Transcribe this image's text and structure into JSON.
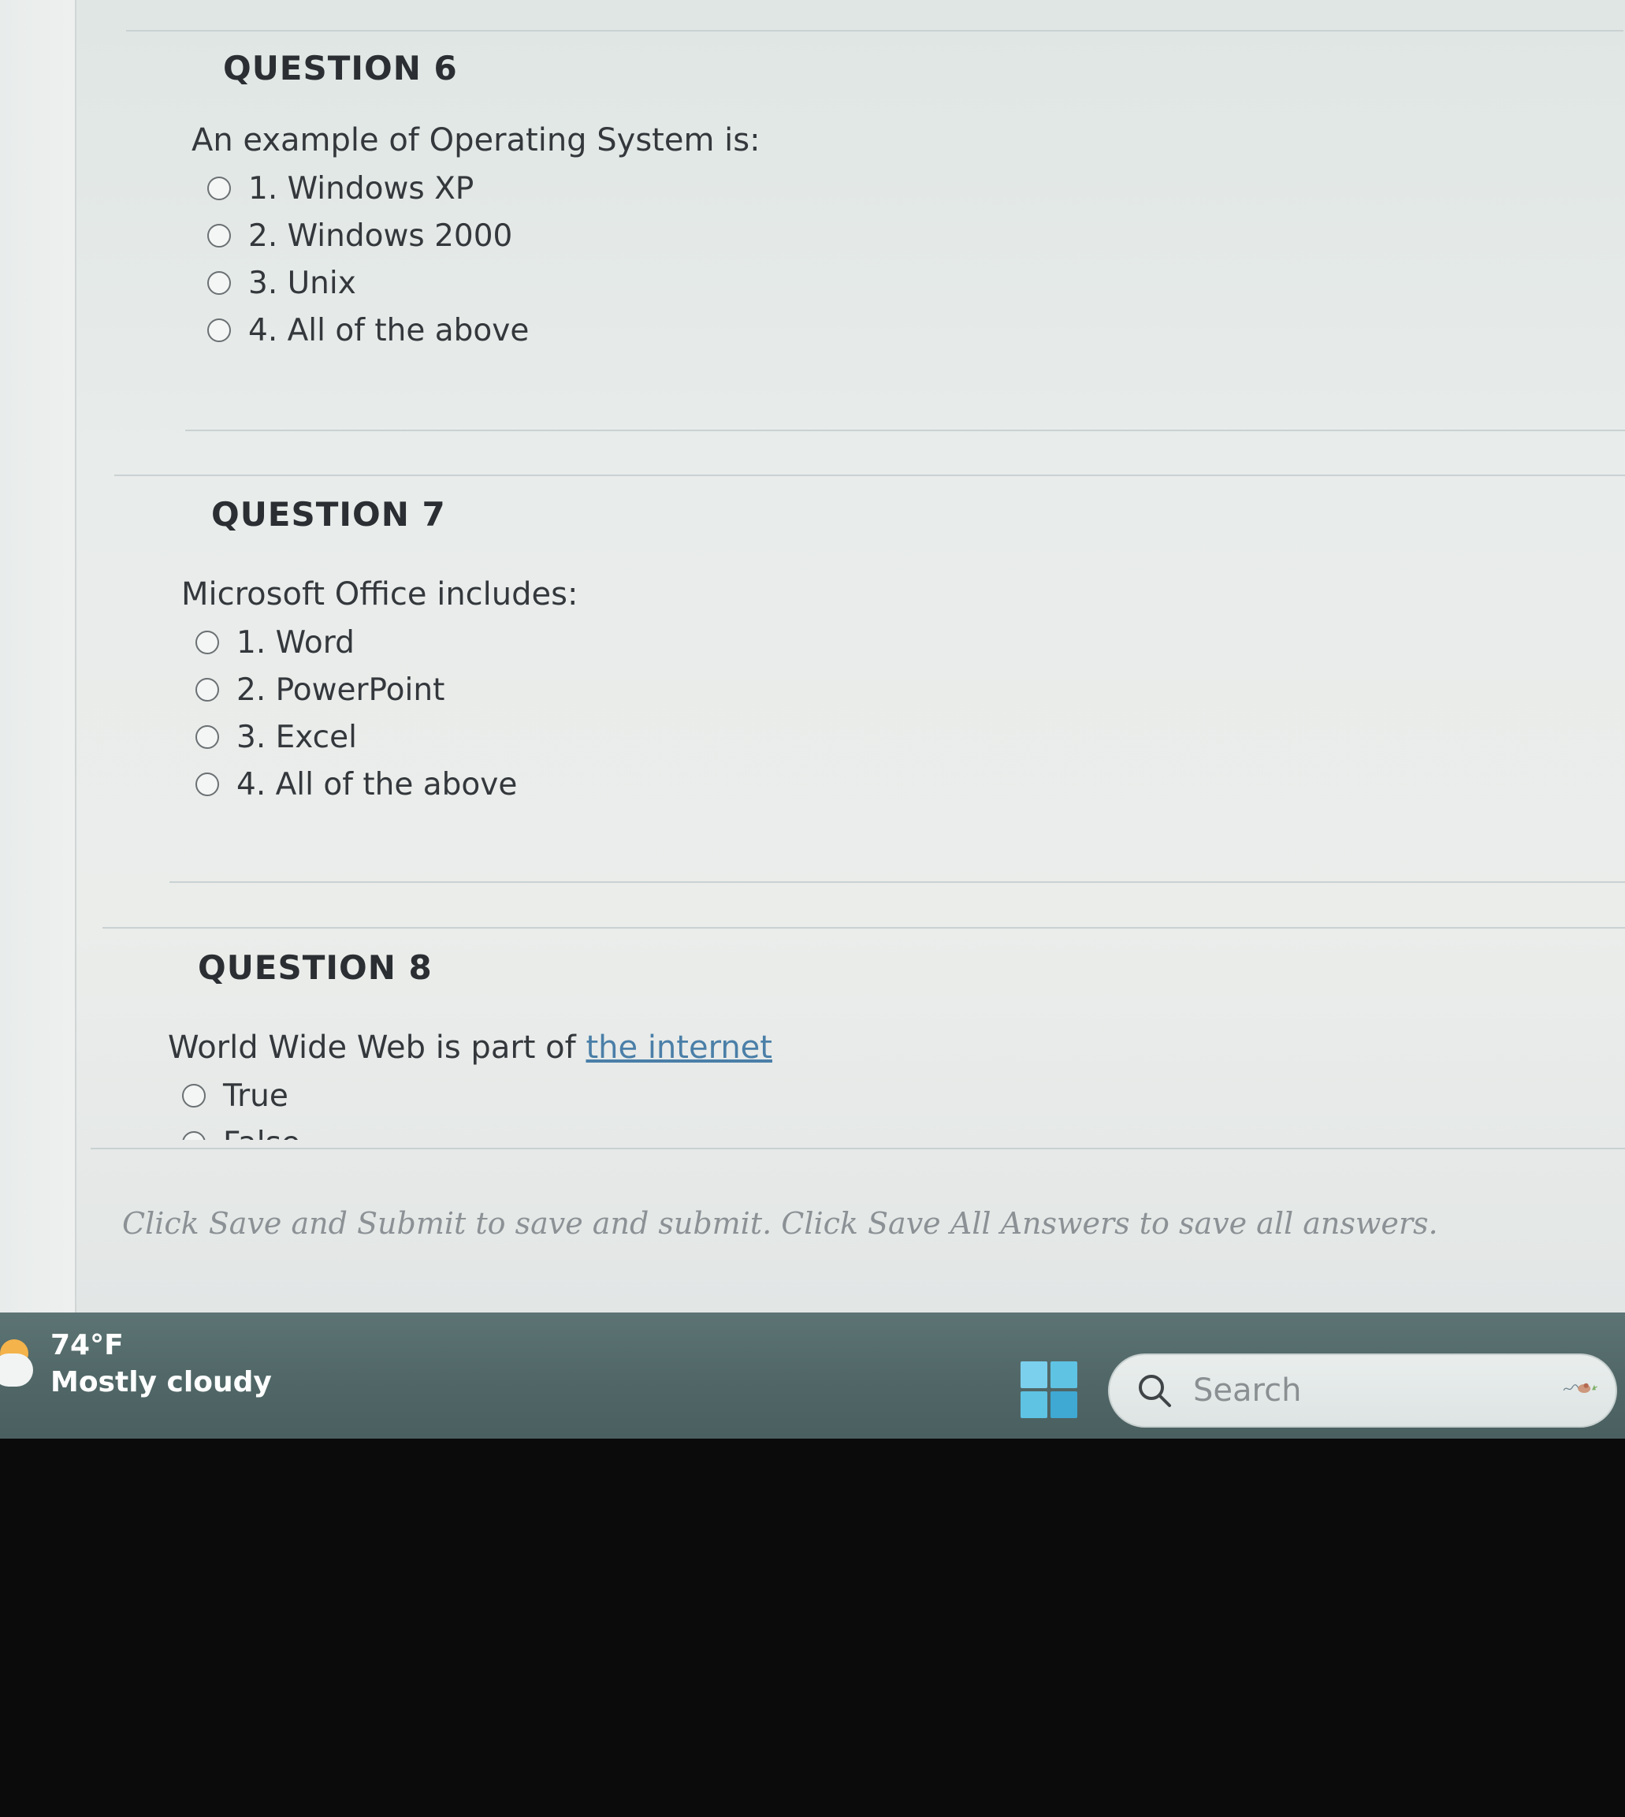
{
  "questions": [
    {
      "title": "QUESTION 6",
      "text": "An example of Operating System is:",
      "options": [
        "1. Windows XP",
        "2. Windows 2000",
        "3. Unix",
        "4. All of the above"
      ]
    },
    {
      "title": "QUESTION 7",
      "text": "Microsoft Office includes:",
      "options": [
        "1. Word",
        "2. PowerPoint",
        "3. Excel",
        "4. All of the above"
      ]
    },
    {
      "title": "QUESTION 8",
      "text_prefix": "World Wide Web is part of ",
      "text_link": "the internet",
      "options": [
        "True",
        "False"
      ]
    }
  ],
  "footer": {
    "note": "Click Save and Submit to save and submit. Click Save All Answers to save all answers."
  },
  "taskbar": {
    "weather_temp": "74°F",
    "weather_desc": "Mostly cloudy",
    "search_placeholder": "Search",
    "start_icon": "windows-logo-icon",
    "weather_icon": "partly-cloudy-icon",
    "search_icon": "search-icon"
  },
  "colors": {
    "link": "#4a7fa8",
    "taskbar": "#516767",
    "start": "#5fc3e4"
  }
}
